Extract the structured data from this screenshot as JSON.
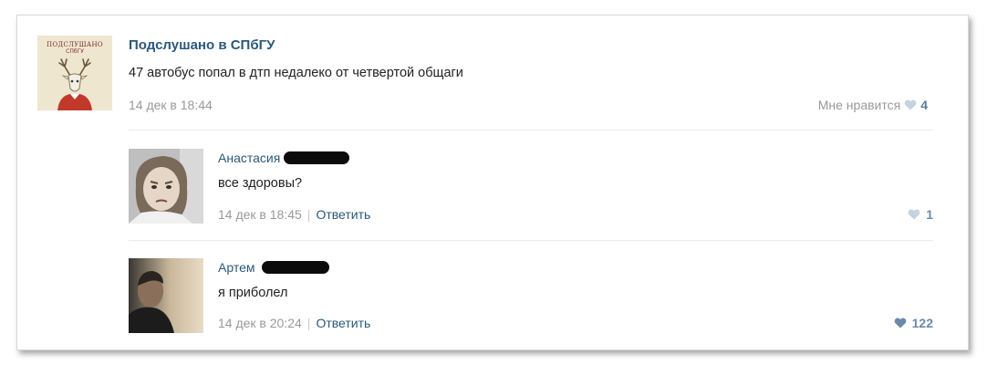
{
  "post": {
    "group_name": "Подслушано в СПбГУ",
    "avatar_title": "ПОДСЛУШАНО",
    "avatar_subtitle": "СПбГУ",
    "text": "47 автобус попал в дтп недалеко от четвертой общаги",
    "date": "14 дек в 18:44",
    "like_label": "Мне нравится",
    "like_count": "4"
  },
  "comments": [
    {
      "author": "Анастасия",
      "text": "все здоровы?",
      "date": "14 дек в 18:45",
      "reply_label": "Ответить",
      "like_count": "1"
    },
    {
      "author": "Артем",
      "text": "я приболел",
      "date": "14 дек в 20:24",
      "reply_label": "Ответить",
      "like_count": "122"
    }
  ],
  "colors": {
    "link": "#2b587a",
    "muted": "#999999",
    "heart_inactive": "#c5d3e0",
    "heart_active": "#6b8aab"
  }
}
